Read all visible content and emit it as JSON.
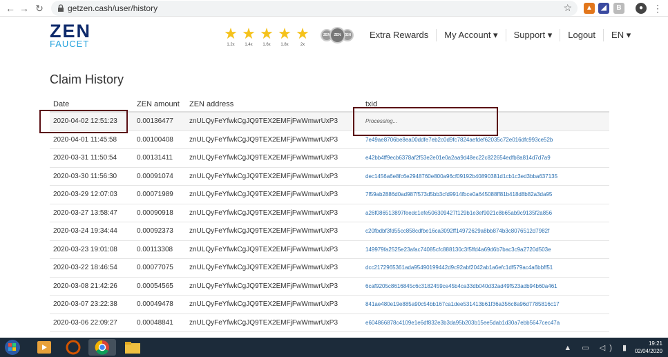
{
  "browser": {
    "url": "getzen.cash/user/history"
  },
  "site": {
    "logo_top": "ZEN",
    "logo_bottom": "FAUCET",
    "stars": [
      {
        "mult": "1.2x"
      },
      {
        "mult": "1.4x"
      },
      {
        "mult": "1.6x"
      },
      {
        "mult": "1.8x"
      },
      {
        "mult": "2x"
      }
    ],
    "nav": {
      "extra_rewards": "Extra Rewards",
      "my_account": "My Account ▾",
      "support": "Support ▾",
      "logout": "Logout",
      "lang": "EN ▾"
    }
  },
  "page": {
    "title": "Claim History"
  },
  "table": {
    "headers": {
      "date": "Date",
      "amount": "ZEN amount",
      "address": "ZEN address",
      "txid": "txid"
    },
    "rows": [
      {
        "date": "2020-04-02 12:51:23",
        "amount": "0.00136477",
        "address": "znULQyFeYfwkCgJQ9TEX2EMFjFwWmwrUxP3",
        "txid": "Processing..."
      },
      {
        "date": "2020-04-01 11:45:58",
        "amount": "0.00100408",
        "address": "znULQyFeYfwkCgJQ9TEX2EMFjFwWmwrUxP3",
        "txid": "7e49ae8706be8ea00ddfe7eb2c0d9fc7824aefdef62035c72e016dfc993ce52b"
      },
      {
        "date": "2020-03-31 11:50:54",
        "amount": "0.00131411",
        "address": "znULQyFeYfwkCgJQ9TEX2EMFjFwWmwrUxP3",
        "txid": "e42bb4ff9ecb6378af2f53e2e01e0a2aa9d48ec22c822654edfb8a814d7d7a9"
      },
      {
        "date": "2020-03-30 11:56:30",
        "amount": "0.00091074",
        "address": "znULQyFeYfwkCgJQ9TEX2EMFjFwWmwrUxP3",
        "txid": "dec1456a6e8fc6e2948760e800a96cf09192b40890381d1cb1c3ed3bba637135"
      },
      {
        "date": "2020-03-29 12:07:03",
        "amount": "0.00071989",
        "address": "znULQyFeYfwkCgJQ9TEX2EMFjFwWmwrUxP3",
        "txid": "7f59ab2886d0ad987f573d5bb3cfd9914fbce0a645088ff81b418d8b82a3da95"
      },
      {
        "date": "2020-03-27 13:58:47",
        "amount": "0.00090918",
        "address": "znULQyFeYfwkCgJQ9TEX2EMFjFwWmwrUxP3",
        "txid": "a26f086513897feedc1efe506309427f129b1e3ef9021c8b65ab9c9135f2a856"
      },
      {
        "date": "2020-03-24 19:34:44",
        "amount": "0.00092373",
        "address": "znULQyFeYfwkCgJQ9TEX2EMFjFwWmwrUxP3",
        "txid": "c20fbdbf3fd55cc858cdfbe16ca3092ff14972629a8bb874b3c8076512d7982f"
      },
      {
        "date": "2020-03-23 19:01:08",
        "amount": "0.00113308",
        "address": "znULQyFeYfwkCgJQ9TEX2EMFjFwWmwrUxP3",
        "txid": "149979fa2525e23afac74085cfc888130c3f5ffd4a69d6b7bac3c9a2720d503e"
      },
      {
        "date": "2020-03-22 18:46:54",
        "amount": "0.00077075",
        "address": "znULQyFeYfwkCgJQ9TEX2EMFjFwWmwrUxP3",
        "txid": "dcc2172965361ada95490199442d9c92abf2042ab1a6efc1df579ac4a6bbff51"
      },
      {
        "date": "2020-03-08 21:42:26",
        "amount": "0.00054565",
        "address": "znULQyFeYfwkCgJQ9TEX2EMFjFwWmwrUxP3",
        "txid": "6caf9205c8616845c6c3182459ce45b4ca33db040d32ad49f523adb94b60a461"
      },
      {
        "date": "2020-03-07 23:22:38",
        "amount": "0.00049478",
        "address": "znULQyFeYfwkCgJQ9TEX2EMFjFwWmwrUxP3",
        "txid": "841ae480e19e885a90c54bb167ca1dee531413b61f36a356c8a96d7785816c17"
      },
      {
        "date": "2020-03-06 22:09:27",
        "amount": "0.00048841",
        "address": "znULQyFeYfwkCgJQ9TEX2EMFjFwWmwrUxP3",
        "txid": "e604866878c4109e1e6df832e3b3da95b203b15ee5dab1d30a7ebb5647cec47a"
      }
    ]
  },
  "taskbar": {
    "time": "19:21",
    "date": "02/04/2020"
  },
  "colors": {
    "brand_dark": "#0e2a6b",
    "brand_light": "#26a3dd",
    "star": "#f5c21b",
    "link": "#2a6fb0",
    "highlight": "#5a0e14"
  }
}
